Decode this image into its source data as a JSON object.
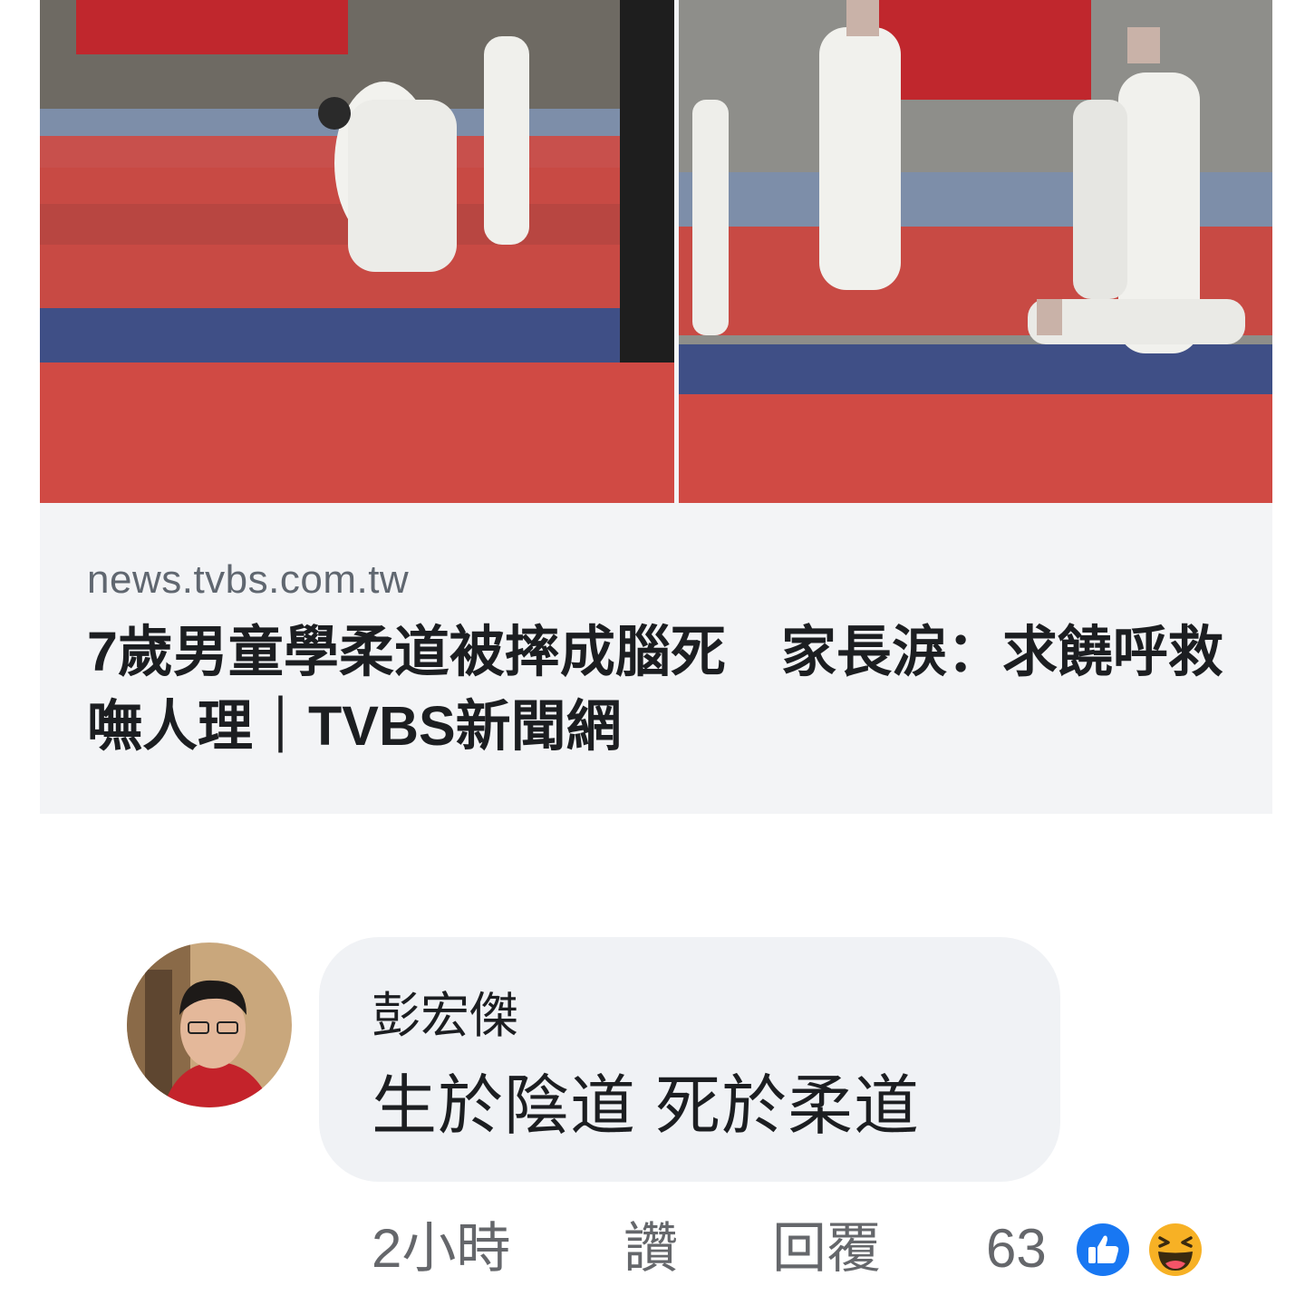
{
  "link_preview": {
    "domain": "news.tvbs.com.tw",
    "headline": "7歲男童學柔道被摔成腦死　家長淚：求饒呼救嘸人理｜TVBS新聞網"
  },
  "comment": {
    "author": "彭宏傑",
    "text": "生於陰道 死於柔道",
    "time": "2小時",
    "like_label": "讚",
    "reply_label": "回覆",
    "reaction_count": "63",
    "reactions": [
      "like-icon",
      "haha-icon"
    ]
  },
  "colors": {
    "like_blue": "#1877f2",
    "haha_yellow": "#f7b125",
    "muted_text": "#65676b",
    "bubble_bg": "#f0f2f5"
  }
}
